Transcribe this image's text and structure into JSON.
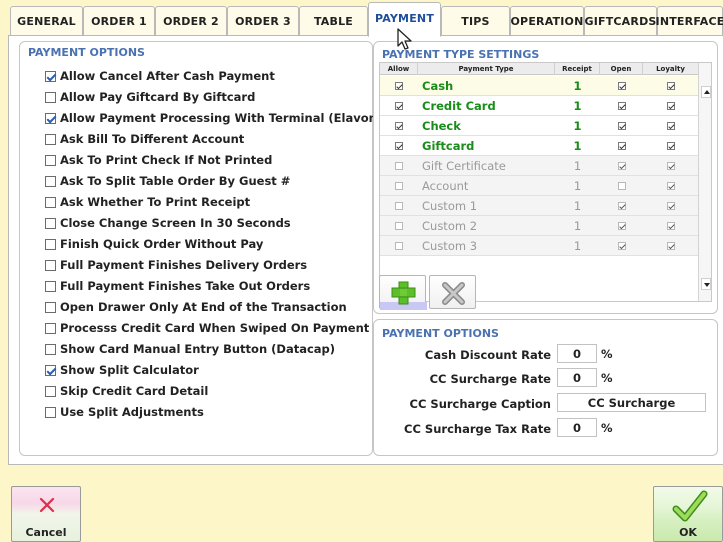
{
  "tabs": [
    {
      "label": "GENERAL"
    },
    {
      "label": "ORDER 1"
    },
    {
      "label": "ORDER 2"
    },
    {
      "label": "ORDER 3"
    },
    {
      "label": "TABLE"
    },
    {
      "label": "PAYMENT",
      "active": true
    },
    {
      "label": "TIPS"
    },
    {
      "label": "OPERATION"
    },
    {
      "label": "GIFTCARDS"
    },
    {
      "label": "INTERFACE"
    }
  ],
  "left_panel": {
    "title": "PAYMENT OPTIONS",
    "options": [
      {
        "label": "Allow Cancel After Cash Payment",
        "checked": true
      },
      {
        "label": "Allow Pay Giftcard By Giftcard",
        "checked": false
      },
      {
        "label": "Allow Payment Processing With Terminal (Elavon)",
        "checked": true
      },
      {
        "label": "Ask Bill To Different Account",
        "checked": false
      },
      {
        "label": "Ask To Print Check If Not Printed",
        "checked": false
      },
      {
        "label": "Ask To Split Table Order By Guest #",
        "checked": false
      },
      {
        "label": "Ask Whether To Print Receipt",
        "checked": false
      },
      {
        "label": "Close Change Screen In 30 Seconds",
        "checked": false
      },
      {
        "label": "Finish Quick Order Without Pay",
        "checked": false
      },
      {
        "label": "Full Payment Finishes Delivery Orders",
        "checked": false
      },
      {
        "label": "Full Payment Finishes Take Out Orders",
        "checked": false
      },
      {
        "label": "Open Drawer Only At End of the Transaction",
        "checked": false
      },
      {
        "label": "Processs Credit Card When Swiped On Payment Screen",
        "checked": false
      },
      {
        "label": "Show Card Manual Entry Button (Datacap)",
        "checked": false
      },
      {
        "label": "Show Split Calculator",
        "checked": true
      },
      {
        "label": "Skip Credit Card Detail",
        "checked": false
      },
      {
        "label": "Use Split Adjustments",
        "checked": false
      }
    ]
  },
  "payment_types": {
    "title": "PAYMENT TYPE SETTINGS",
    "columns": [
      "Allow",
      "Payment Type",
      "Receipt",
      "Open",
      "Loyalty"
    ],
    "rows": [
      {
        "allow": true,
        "name": "Cash",
        "receipt": "1",
        "open": true,
        "loyalty": true,
        "enabled": true
      },
      {
        "allow": true,
        "name": "Credit Card",
        "receipt": "1",
        "open": true,
        "loyalty": true,
        "enabled": true
      },
      {
        "allow": true,
        "name": "Check",
        "receipt": "1",
        "open": true,
        "loyalty": true,
        "enabled": true
      },
      {
        "allow": true,
        "name": "Giftcard",
        "receipt": "1",
        "open": true,
        "loyalty": true,
        "enabled": true
      },
      {
        "allow": false,
        "name": "Gift Certificate",
        "receipt": "1",
        "open": true,
        "loyalty": true,
        "enabled": false
      },
      {
        "allow": false,
        "name": "Account",
        "receipt": "1",
        "open": false,
        "loyalty": true,
        "enabled": false
      },
      {
        "allow": false,
        "name": "Custom 1",
        "receipt": "1",
        "open": true,
        "loyalty": true,
        "enabled": false
      },
      {
        "allow": false,
        "name": "Custom 2",
        "receipt": "1",
        "open": true,
        "loyalty": true,
        "enabled": false
      },
      {
        "allow": false,
        "name": "Custom 3",
        "receipt": "1",
        "open": true,
        "loyalty": true,
        "enabled": false
      }
    ]
  },
  "payment_options": {
    "title": "PAYMENT OPTIONS",
    "cash_discount_label": "Cash Discount Rate",
    "cash_discount_value": "0",
    "cc_surcharge_rate_label": "CC Surcharge Rate",
    "cc_surcharge_rate_value": "0",
    "cc_surcharge_caption_label": "CC Surcharge Caption",
    "cc_surcharge_caption_value": "CC Surcharge",
    "cc_surcharge_tax_label": "CC Surcharge Tax Rate",
    "cc_surcharge_tax_value": "0",
    "percent": "%"
  },
  "footer": {
    "cancel_label": "Cancel",
    "ok_label": "OK"
  },
  "colors": {
    "background": "#fdf6c8",
    "accent_blue": "#4a72b0",
    "enabled_green": "#1a8c1a",
    "disabled_gray": "#9a9a9a"
  }
}
